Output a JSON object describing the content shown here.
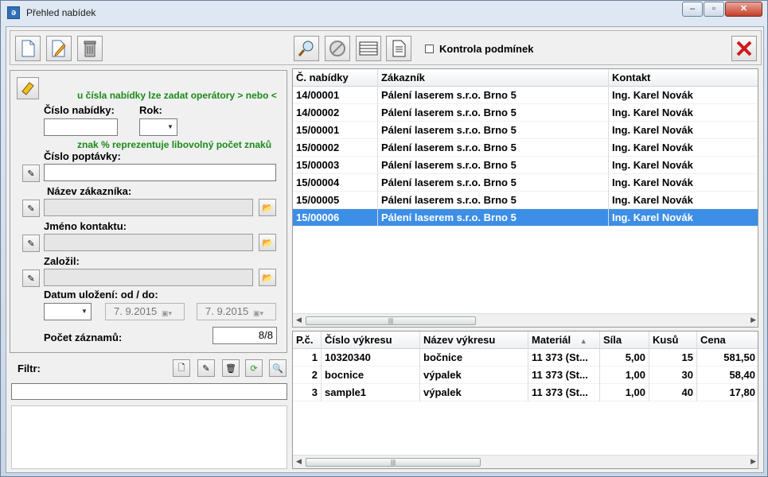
{
  "window": {
    "title": "Přehled nabídek",
    "min": "–",
    "max": "▫",
    "close": "✕"
  },
  "toolbar": {
    "checkbox_label": "Kontrola podmínek"
  },
  "filter_panel": {
    "hint_operators": "u čísla nabídky lze zadat operátory > nebo <",
    "label_cislo_nabidky": "Číslo nabídky:",
    "label_rok": "Rok:",
    "hint_percent": "znak % reprezentuje libovolný počet znaků",
    "label_cislo_poptavky": "Číslo poptávky:",
    "label_nazev_zakaznika": "Název zákazníka:",
    "label_jmeno_kontaktu": "Jméno kontaktu:",
    "label_zalozil": "Založil:",
    "label_datum": "Datum uložení:  od / do:",
    "date_from": "7.  9.2015",
    "date_to": "7.  9.2015",
    "label_pocet": "Počet záznamů:",
    "pocet_value": "8/8"
  },
  "filter_section": {
    "label": "Filtr:"
  },
  "offers_table": {
    "columns": [
      "Č. nabídky",
      "Zákazník",
      "Kontakt"
    ],
    "rows": [
      [
        "14/00001",
        "Pálení laserem s.r.o. Brno 5",
        "Ing. Karel Novák"
      ],
      [
        "14/00002",
        "Pálení laserem s.r.o. Brno 5",
        "Ing. Karel Novák"
      ],
      [
        "15/00001",
        "Pálení laserem s.r.o. Brno 5",
        "Ing. Karel Novák"
      ],
      [
        "15/00002",
        "Pálení laserem s.r.o. Brno 5",
        "Ing. Karel Novák"
      ],
      [
        "15/00003",
        "Pálení laserem s.r.o. Brno 5",
        "Ing. Karel Novák"
      ],
      [
        "15/00004",
        "Pálení laserem s.r.o. Brno 5",
        "Ing. Karel Novák"
      ],
      [
        "15/00005",
        "Pálení laserem s.r.o. Brno 5",
        "Ing. Karel Novák"
      ],
      [
        "15/00006",
        "Pálení laserem s.r.o. Brno 5",
        "Ing. Karel Novák"
      ]
    ],
    "selected_index": 7
  },
  "drawings_table": {
    "columns": [
      "P.č.",
      "Číslo výkresu",
      "Název výkresu",
      "Materiál",
      "Síla",
      "Kusů",
      "Cena"
    ],
    "sort_indicator": "▲",
    "rows": [
      [
        "1",
        "10320340",
        "bočnice",
        "11 373 (St...",
        "5,00",
        "15",
        "581,50"
      ],
      [
        "2",
        "bocnice",
        "výpalek",
        "11 373 (St...",
        "1,00",
        "30",
        "58,40"
      ],
      [
        "3",
        "sample1",
        "výpalek",
        "11 373 (St...",
        "1,00",
        "40",
        "17,80"
      ]
    ]
  },
  "colors": {
    "selection": "#3d8ee6",
    "hint_green": "#1a8a1a",
    "close_red": "#c4412a"
  }
}
